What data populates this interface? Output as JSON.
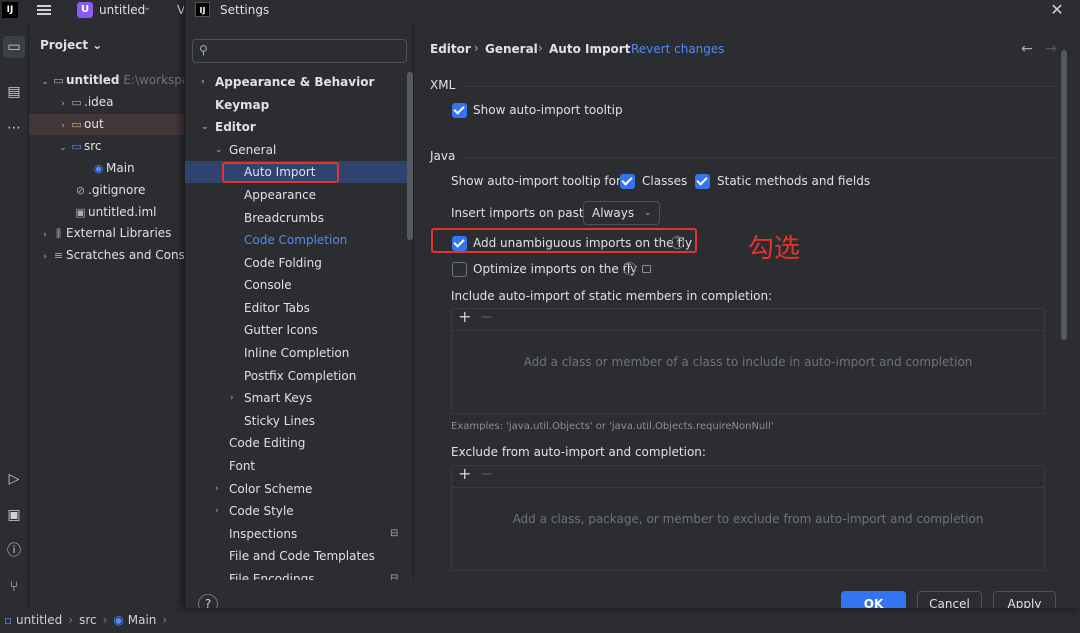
{
  "ide": {
    "logo": "IJ",
    "project_badge": "U",
    "project_name": "untitled",
    "vcs_letter": "V",
    "stripe_icons": [
      "folder-icon",
      "structure-icon",
      "more-icon",
      "run-icon",
      "terminal-icon",
      "problems-icon",
      "git-icon"
    ],
    "project_panel": {
      "header": "Project",
      "tree": [
        {
          "label": "untitled",
          "dim": "E:\\workspa"
        },
        {
          "label": ".idea"
        },
        {
          "label": "out"
        },
        {
          "label": "src"
        },
        {
          "label": "Main"
        },
        {
          "label": ".gitignore"
        },
        {
          "label": "untitled.iml"
        },
        {
          "label": "External Libraries"
        },
        {
          "label": "Scratches and Conso"
        }
      ]
    },
    "statusbar": {
      "project": "untitled",
      "src": "src",
      "main": "Main"
    }
  },
  "dialog": {
    "title": "Settings",
    "search": {
      "placeholder": "",
      "value": ""
    },
    "nav": [
      {
        "label": "Appearance & Behavior"
      },
      {
        "label": "Keymap"
      },
      {
        "label": "Editor"
      },
      {
        "label": "General"
      },
      {
        "label": "Auto Import"
      },
      {
        "label": "Appearance"
      },
      {
        "label": "Breadcrumbs"
      },
      {
        "label": "Code Completion"
      },
      {
        "label": "Code Folding"
      },
      {
        "label": "Console"
      },
      {
        "label": "Editor Tabs"
      },
      {
        "label": "Gutter Icons"
      },
      {
        "label": "Inline Completion"
      },
      {
        "label": "Postfix Completion"
      },
      {
        "label": "Smart Keys"
      },
      {
        "label": "Sticky Lines"
      },
      {
        "label": "Code Editing"
      },
      {
        "label": "Font"
      },
      {
        "label": "Color Scheme"
      },
      {
        "label": "Code Style"
      },
      {
        "label": "Inspections"
      },
      {
        "label": "File and Code Templates"
      },
      {
        "label": "File Encodings"
      }
    ],
    "breadcrumb": [
      "Editor",
      "General",
      "Auto Import"
    ],
    "revert_label": "Revert changes",
    "xml": {
      "section": "XML",
      "show_tooltip": "Show auto-import tooltip"
    },
    "java": {
      "section": "Java",
      "tooltip_for": "Show auto-import tooltip for:",
      "classes": "Classes",
      "static_methods": "Static methods and fields",
      "insert_on_paste": "Insert imports on paste:",
      "paste_value": "Always",
      "add_unambiguous": "Add unambiguous imports on the fly",
      "optimize": "Optimize imports on the fly",
      "include_static": "Include auto-import of static members in completion:",
      "include_empty": "Add a class or member of a class to include in auto-import and completion",
      "examples": "Examples: 'java.util.Objects' or 'java.util.Objects.requireNonNull'",
      "exclude": "Exclude from auto-import and completion:",
      "exclude_empty": "Add a class, package, or member to exclude from auto-import and completion"
    },
    "annotation": "勾选",
    "buttons": {
      "ok": "OK",
      "cancel": "Cancel",
      "apply": "Apply"
    },
    "colors": {
      "accent": "#3574f0",
      "highlight_box": "#e5322d",
      "link": "#548af7"
    }
  }
}
